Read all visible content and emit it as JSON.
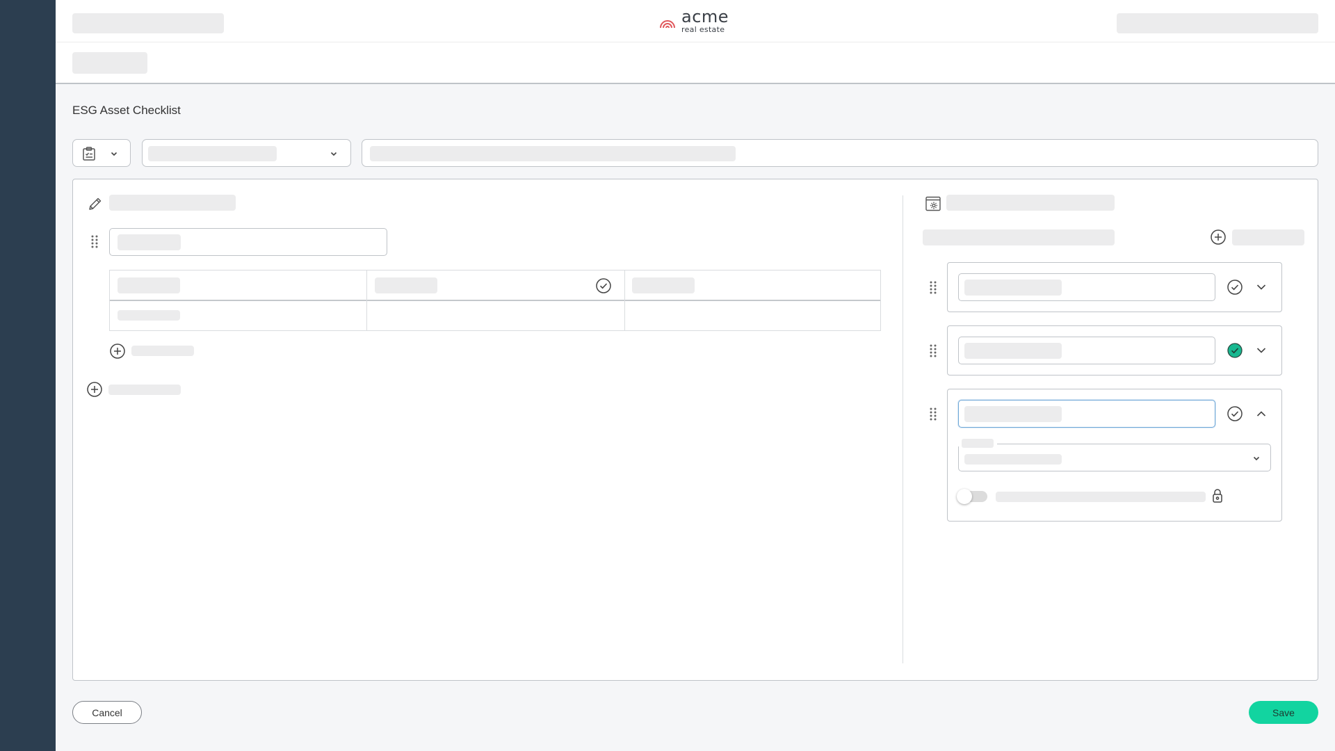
{
  "brand": {
    "logo_main": "acme",
    "logo_sub": "real estate",
    "logo_color": "#e0575b"
  },
  "page": {
    "title": "ESG Asset Checklist"
  },
  "footer": {
    "cancel_label": "Cancel",
    "save_label": "Save"
  },
  "colors": {
    "sidebar": "#2c3e50",
    "accent": "#12d4a0",
    "check_active": "#17b890",
    "focus_border": "#6fa8d8"
  },
  "icons": {
    "template": "clipboard-check-icon",
    "edit": "pencil-icon",
    "settings": "settings-window-icon",
    "drag": "drag-handle-icon",
    "check": "check-circle-icon",
    "add": "plus-circle-icon",
    "lock": "lock-icon"
  },
  "state": {
    "card_2_checked": true,
    "card_3_expanded": true,
    "toggle_on": false
  }
}
